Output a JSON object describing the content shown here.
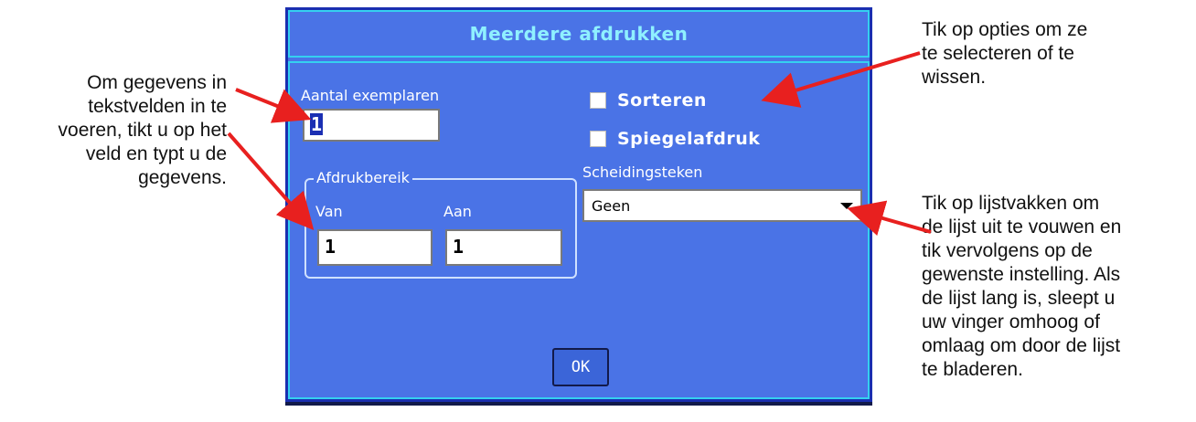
{
  "dialog": {
    "title": "Meerdere afdrukken",
    "copies_label": "Aantal exemplaren",
    "copies_value": "1",
    "collate_label": "Sorteren",
    "mirror_label": "Spiegelafdruk",
    "range_label": "Afdrukbereik",
    "from_label": "Van",
    "to_label": "Aan",
    "from_value": "1",
    "to_value": "1",
    "separator_label": "Scheidingsteken",
    "separator_value": "Geen",
    "ok_label": "OK",
    "colors": {
      "background": "#4a73e6",
      "frame": "#35d0f0",
      "title_text": "#8ff0ff",
      "arrow": "#e8201f"
    }
  },
  "callouts": {
    "left": [
      "Om gegevens in",
      "tekstvelden in te",
      "voeren, tikt u op het",
      "veld en typt u de",
      "gegevens."
    ],
    "top_right": [
      "Tik op opties om ze",
      "te selecteren of te",
      "wissen."
    ],
    "right": [
      "Tik op lijstvakken om",
      "de lijst uit te vouwen en",
      "tik vervolgens op de",
      "gewenste instelling. Als",
      "de lijst lang is, sleept u",
      "uw vinger omhoog of",
      "omlaag om door de lijst",
      "te bladeren."
    ]
  }
}
